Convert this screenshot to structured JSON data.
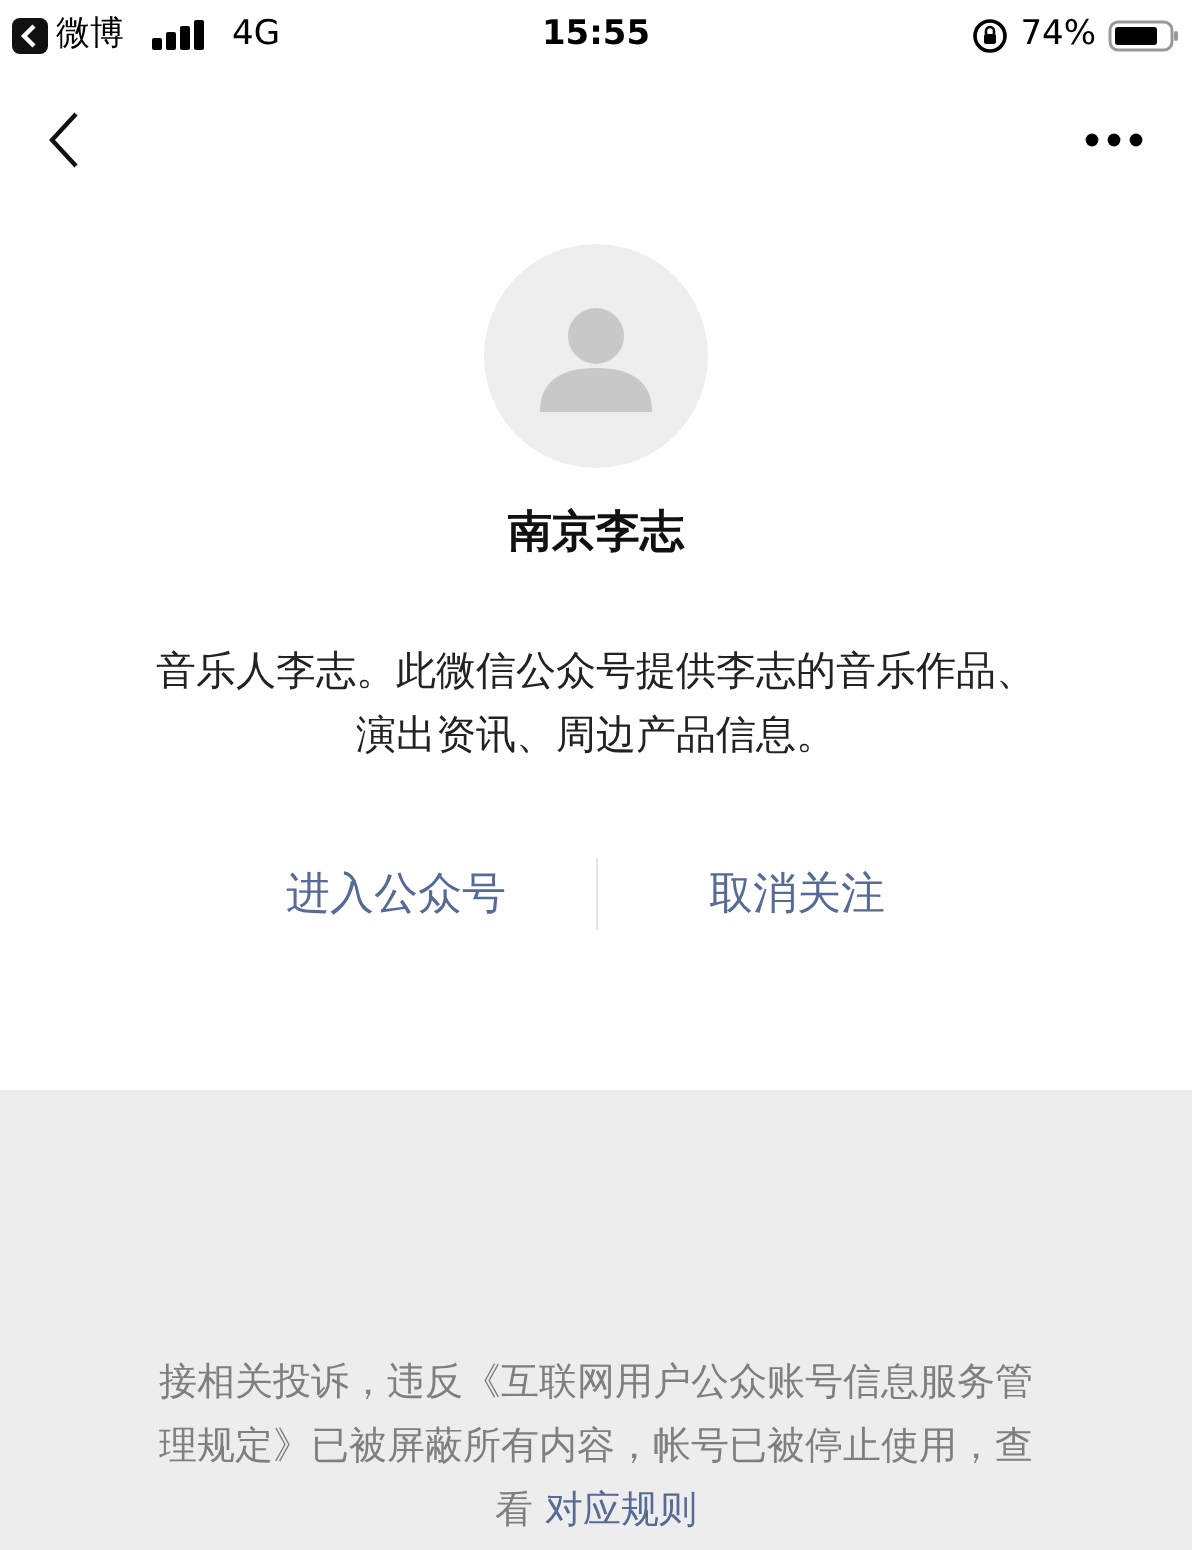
{
  "status_bar": {
    "back_app": "微博",
    "network": "4G",
    "time": "15:55",
    "battery": "74%"
  },
  "profile": {
    "name": "南京李志",
    "description": "音乐人李志。此微信公众号提供李志的音乐作品、演出资讯、周边产品信息。"
  },
  "actions": [
    "进入公众号",
    "取消关注"
  ],
  "notice": {
    "text": "接相关投诉，违反《互联网用户公众账号信息服务管理规定》已被屏蔽所有内容，帐号已被停止使用，查看 ",
    "link": "对应规则"
  }
}
